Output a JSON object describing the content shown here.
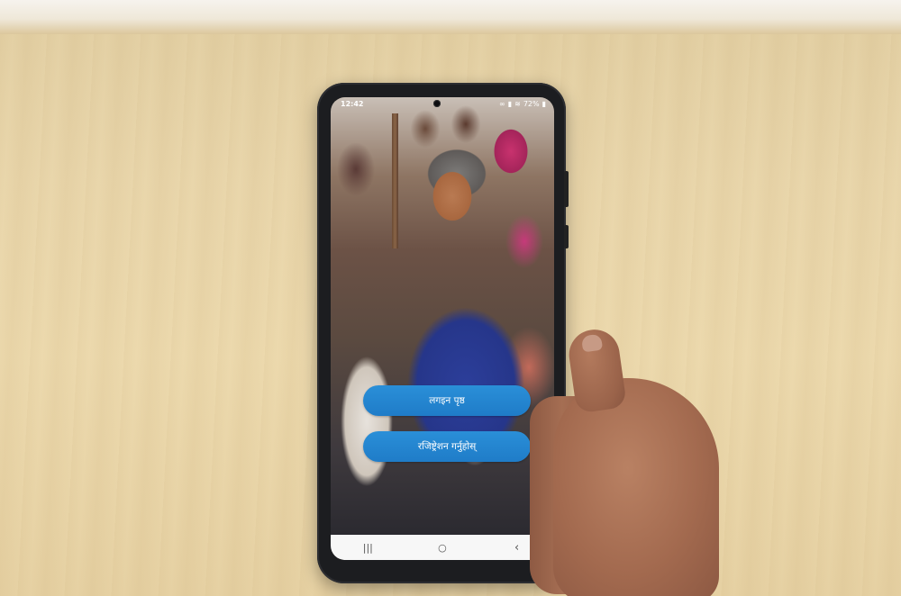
{
  "status_bar": {
    "time": "12:42",
    "battery": "72%"
  },
  "buttons": {
    "login": "लगइन पृष्ठ",
    "register": "रजिष्ट्रेशन गर्नुहोस्"
  },
  "nav": {
    "recents_icon": "recents-icon",
    "home_icon": "home-icon",
    "back_icon": "back-icon"
  },
  "colors": {
    "button_blue": "#2086d0",
    "navbar_bg": "#f7f7f7"
  }
}
